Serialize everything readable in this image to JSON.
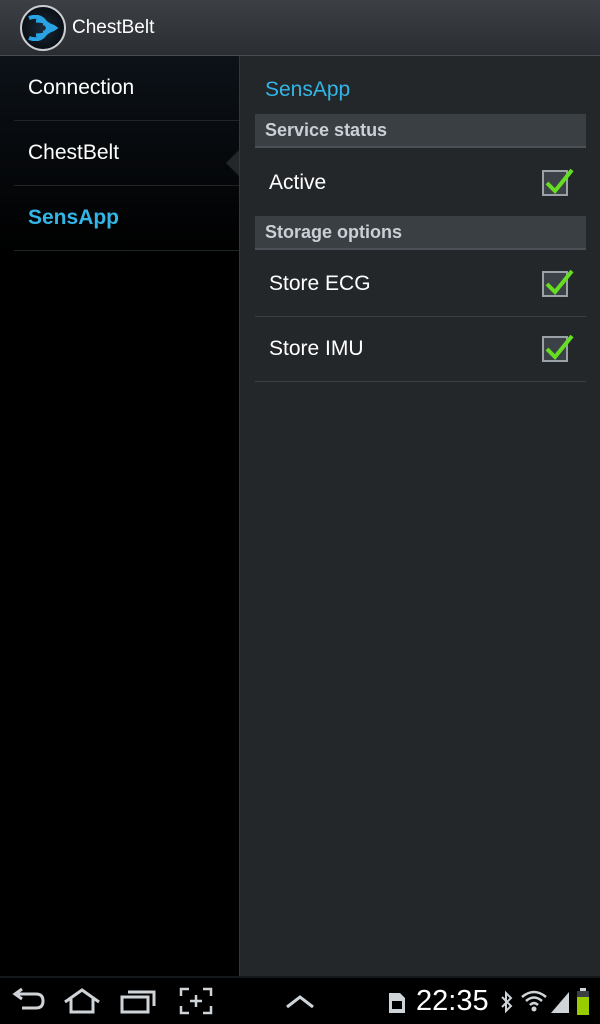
{
  "app": {
    "title": "ChestBelt",
    "icon": "chestbelt-logo-icon"
  },
  "headers": [
    {
      "label": "Connection",
      "selected": false
    },
    {
      "label": "ChestBelt",
      "selected": false
    },
    {
      "label": "SensApp",
      "selected": true
    }
  ],
  "content": {
    "breadcrumb": "SensApp",
    "categories": [
      {
        "title": "Service status",
        "items": [
          {
            "label": "Active",
            "checked": true
          }
        ]
      },
      {
        "title": "Storage options",
        "items": [
          {
            "label": "Store ECG",
            "checked": true
          },
          {
            "label": "Store IMU",
            "checked": true
          }
        ]
      }
    ]
  },
  "system_bar": {
    "time": "22:35",
    "nav_icons": [
      "back-icon",
      "home-icon",
      "recent-apps-icon",
      "screenshot-icon",
      "menu-up-icon"
    ],
    "status_icons": [
      "sd-card-icon",
      "bluetooth-icon",
      "wifi-icon",
      "signal-icon",
      "battery-icon"
    ]
  },
  "colors": {
    "accent": "#33b5e5",
    "check": "#66dd22",
    "battery": "#99cc00"
  }
}
